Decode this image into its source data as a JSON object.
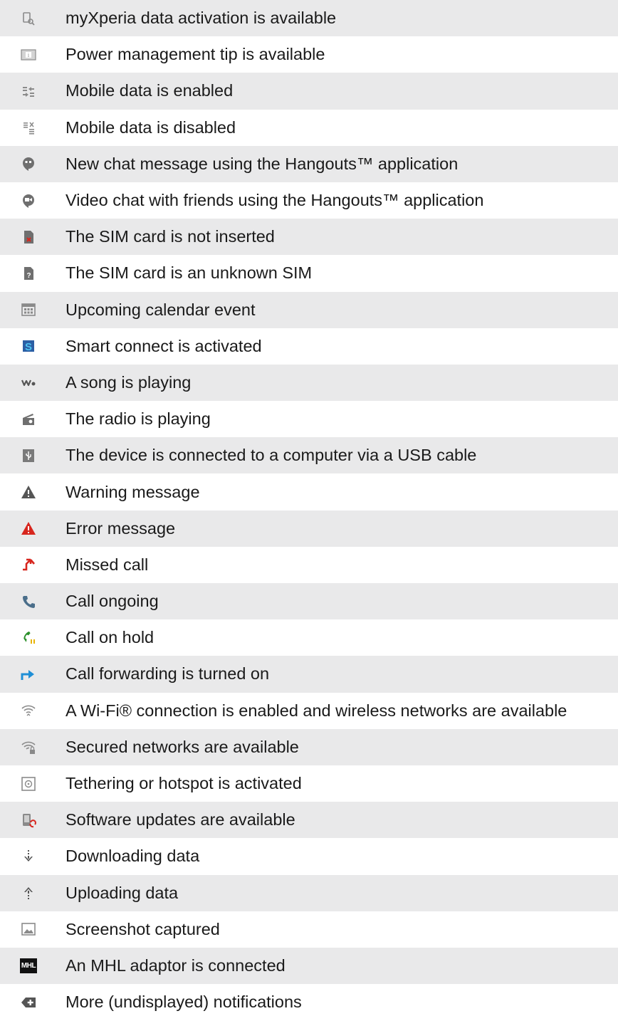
{
  "rows": [
    {
      "icon": "myxperia-icon",
      "text": "myXperia data activation is available"
    },
    {
      "icon": "power-tip-icon",
      "text": "Power management tip is available"
    },
    {
      "icon": "mobile-data-enabled-icon",
      "text": "Mobile data is enabled"
    },
    {
      "icon": "mobile-data-disabled-icon",
      "text": "Mobile data is disabled"
    },
    {
      "icon": "hangouts-chat-icon",
      "text": "New chat message using the Hangouts™ application"
    },
    {
      "icon": "hangouts-video-icon",
      "text": "Video chat with friends using the Hangouts™ application"
    },
    {
      "icon": "sim-not-inserted-icon",
      "text": "The SIM card is not inserted"
    },
    {
      "icon": "sim-unknown-icon",
      "text": "The SIM card is an unknown SIM"
    },
    {
      "icon": "calendar-icon",
      "text": "Upcoming calendar event"
    },
    {
      "icon": "smart-connect-icon",
      "text": "Smart connect is activated"
    },
    {
      "icon": "walkman-icon",
      "text": "A song is playing"
    },
    {
      "icon": "radio-icon",
      "text": "The radio is playing"
    },
    {
      "icon": "usb-icon",
      "text": "The device is connected to a computer via a USB cable"
    },
    {
      "icon": "warning-icon",
      "text": "Warning message"
    },
    {
      "icon": "error-icon",
      "text": "Error message"
    },
    {
      "icon": "missed-call-icon",
      "text": "Missed call"
    },
    {
      "icon": "call-ongoing-icon",
      "text": "Call ongoing"
    },
    {
      "icon": "call-hold-icon",
      "text": "Call on hold"
    },
    {
      "icon": "call-forward-icon",
      "text": "Call forwarding is turned on"
    },
    {
      "icon": "wifi-icon",
      "text": "A Wi-Fi® connection is enabled and wireless networks are available"
    },
    {
      "icon": "wifi-secured-icon",
      "text": "Secured networks are available"
    },
    {
      "icon": "tethering-icon",
      "text": "Tethering or hotspot is activated"
    },
    {
      "icon": "software-update-icon",
      "text": "Software updates are available"
    },
    {
      "icon": "download-icon",
      "text": "Downloading data"
    },
    {
      "icon": "upload-icon",
      "text": "Uploading data"
    },
    {
      "icon": "screenshot-icon",
      "text": "Screenshot captured"
    },
    {
      "icon": "mhl-icon",
      "text": "An MHL adaptor is connected",
      "icon_text": "MHL"
    },
    {
      "icon": "more-notifications-icon",
      "text": "More (undisplayed) notifications"
    }
  ],
  "colors": {
    "shade": "#e9e9ea",
    "icon_gray": "#8a8a8a",
    "red": "#d7261e",
    "blue": "#1f8fd6",
    "green": "#2a8f2a"
  }
}
